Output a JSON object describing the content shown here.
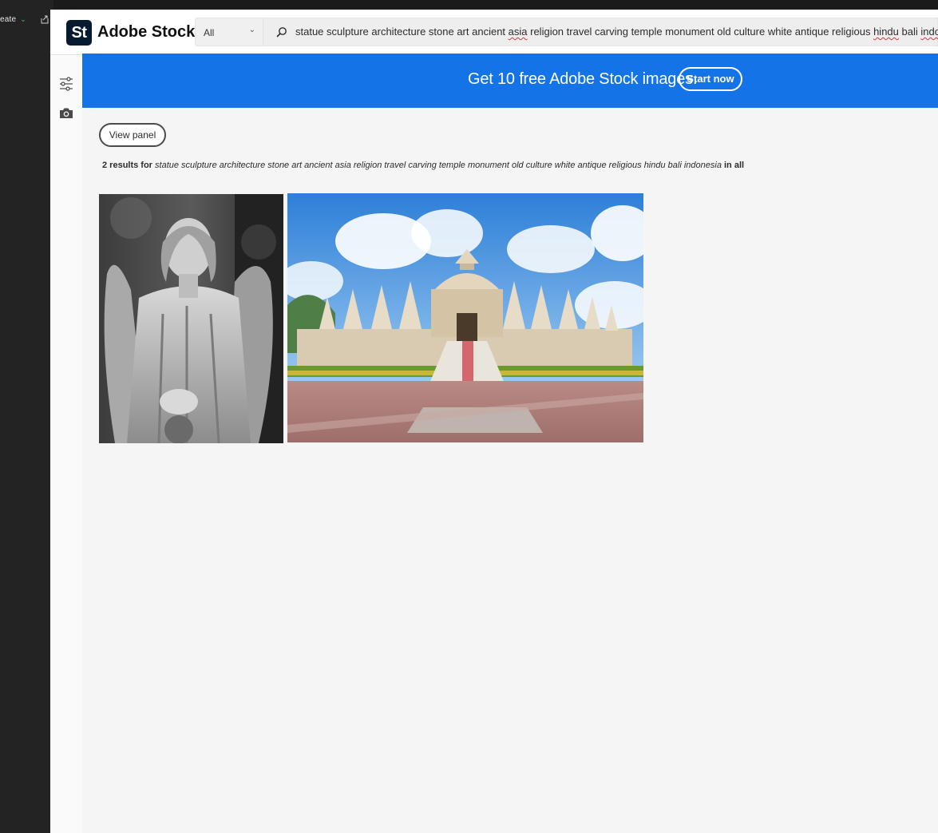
{
  "host": {
    "create_label": "eate",
    "create_chevron": "⌄"
  },
  "header": {
    "logo_text": "St",
    "brand_name": "Adobe Stock",
    "filter": {
      "selected": "All",
      "chevron": "⌄"
    },
    "search": {
      "query_parts": [
        "statue sculpture architecture stone art ancient ",
        "asia",
        " religion travel carving temple monument old culture white antique religious ",
        "hindu",
        " bali ",
        "indonesia"
      ]
    }
  },
  "banner": {
    "text": "Get 10 free Adobe Stock images.",
    "button_label": "Start now",
    "color": "#1473e6"
  },
  "main": {
    "view_panel_label": "View panel",
    "results": {
      "count_text": "2 results for",
      "query": "statue sculpture architecture stone art ancient asia religion travel carving temple monument old culture white antique religious hindu bali indonesia",
      "suffix": "in all"
    },
    "thumbnails": [
      {
        "subject": "angel-statue-black-and-white"
      },
      {
        "subject": "white-stone-temple-blue-sky"
      }
    ]
  },
  "icons": {
    "rail": [
      "filter-sliders-icon",
      "camera-icon"
    ],
    "search": "search-icon",
    "host": "share-icon"
  }
}
